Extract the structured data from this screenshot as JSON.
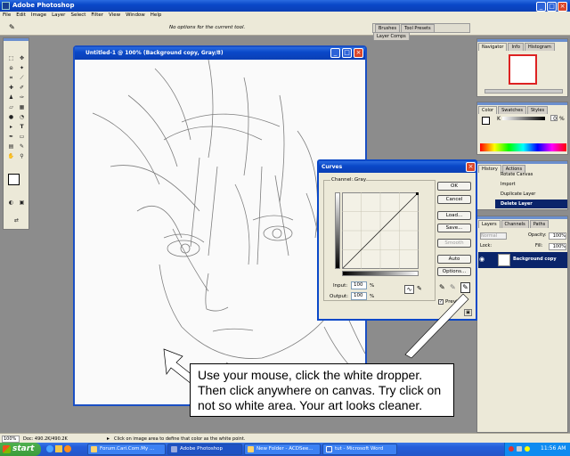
{
  "app": {
    "title": "Adobe Photoshop"
  },
  "menu": [
    "File",
    "Edit",
    "Image",
    "Layer",
    "Select",
    "Filter",
    "View",
    "Window",
    "Help"
  ],
  "options": {
    "hint": "No options for the current tool.",
    "tabs": [
      "Brushes",
      "Tool Presets",
      "Layer Comps"
    ]
  },
  "document": {
    "title": "Untitled-1 @ 100% (Background copy, Gray/8)"
  },
  "navigator": {
    "tabs": [
      "Navigator",
      "Info",
      "Histogram"
    ]
  },
  "color": {
    "tabs": [
      "Color",
      "Swatches",
      "Styles"
    ],
    "channel": "K",
    "value": "0",
    "unit": "%"
  },
  "history": {
    "tabs": [
      "History",
      "Actions"
    ],
    "items": [
      "Rotate Canvas",
      "Import",
      "Duplicate Layer",
      "Delete Layer"
    ]
  },
  "layers": {
    "tabs": [
      "Layers",
      "Channels",
      "Paths"
    ],
    "mode": "Normal",
    "opacity_label": "Opacity:",
    "opacity": "100%",
    "lock_label": "Lock:",
    "fill_label": "Fill:",
    "fill": "100%",
    "layer_name": "Background copy"
  },
  "curves": {
    "title": "Curves",
    "channel_label": "Channel:",
    "channel": "Gray",
    "input_label": "Input:",
    "input": "100",
    "output_label": "Output:",
    "output": "100",
    "percent": "%",
    "buttons": [
      "OK",
      "Cancel",
      "Load...",
      "Save...",
      "Smooth",
      "Auto",
      "Options..."
    ],
    "preview": "Preview"
  },
  "callout": {
    "text": "Use your mouse, click the white dropper. Then click anywhere on canvas. Try click on not so white area. Your art looks cleaner."
  },
  "status": {
    "zoom": "100%",
    "doc": "Doc: 490.2K/490.2K",
    "hint": "Click on image area to define that color as the white point."
  },
  "taskbar": {
    "start": "start",
    "items": [
      "Forum.Cari.Com.My ...",
      "Adobe Photoshop",
      "New Folder - ACDSee...",
      "tut - Microsoft Word"
    ],
    "time": "11:56 AM"
  },
  "colors": {
    "title_blue": "#0a48c8",
    "taskbar": "#245edb",
    "start_green": "#3a9c3a"
  }
}
